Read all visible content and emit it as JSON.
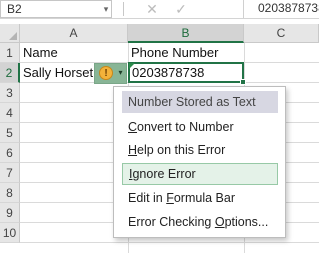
{
  "formula_bar": {
    "name_box": "B2",
    "name_box_dropdown": "▾",
    "cancel_glyph": "✕",
    "enter_glyph": "✓",
    "value": "0203878738"
  },
  "columns": [
    "A",
    "B",
    "C"
  ],
  "rows": [
    "1",
    "2",
    "3",
    "4",
    "5",
    "6",
    "7",
    "8",
    "9",
    "10"
  ],
  "cells": {
    "a1": "Name",
    "b1": "Phone Number",
    "a2": "Sally Horset",
    "b2": "0203878738"
  },
  "smart_tag": {
    "warning_glyph": "!",
    "arrow_glyph": "▾"
  },
  "menu": {
    "header": "Number Stored as Text",
    "items": [
      {
        "pre": "",
        "ul": "C",
        "post": "onvert to Number"
      },
      {
        "pre": "",
        "ul": "H",
        "post": "elp on this Error"
      },
      {
        "pre": "",
        "ul": "I",
        "post": "gnore Error"
      },
      {
        "pre": "Edit in ",
        "ul": "F",
        "post": "ormula Bar"
      },
      {
        "pre": "Error Checking ",
        "ul": "O",
        "post": "ptions..."
      }
    ]
  },
  "colors": {
    "accent": "#217346",
    "menu_hover": "#e4f2e8",
    "menu_header": "#d7d7e2",
    "warning": "#f3b23a"
  }
}
